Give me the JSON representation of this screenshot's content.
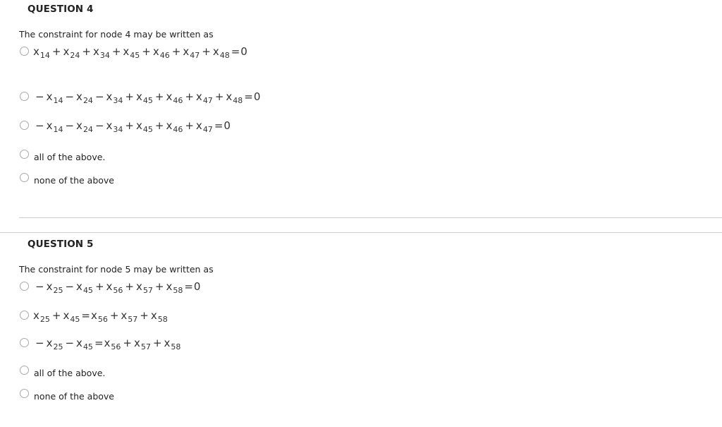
{
  "questions": [
    {
      "title": "QUESTION 4",
      "prompt": "The constraint for node 4 may be written as",
      "options": [
        {
          "type": "math",
          "tokens": [
            {
              "v": "x",
              "s": "14"
            },
            {
              "op": "+"
            },
            {
              "v": "x",
              "s": "24"
            },
            {
              "op": "+"
            },
            {
              "v": "x",
              "s": "34"
            },
            {
              "op": "+"
            },
            {
              "v": "x",
              "s": "45"
            },
            {
              "op": "+"
            },
            {
              "v": "x",
              "s": "46"
            },
            {
              "op": "+"
            },
            {
              "v": "x",
              "s": "47"
            },
            {
              "op": "+"
            },
            {
              "v": "x",
              "s": "48"
            },
            {
              "eq": "="
            },
            {
              "c": "0"
            }
          ]
        },
        {
          "type": "math",
          "tokens": [
            {
              "op": "−"
            },
            {
              "v": "x",
              "s": "14"
            },
            {
              "op": "−"
            },
            {
              "v": "x",
              "s": "24"
            },
            {
              "op": "−"
            },
            {
              "v": "x",
              "s": "34"
            },
            {
              "op": "+"
            },
            {
              "v": "x",
              "s": "45"
            },
            {
              "op": "+"
            },
            {
              "v": "x",
              "s": "46"
            },
            {
              "op": "+"
            },
            {
              "v": "x",
              "s": "47"
            },
            {
              "op": "+"
            },
            {
              "v": "x",
              "s": "48"
            },
            {
              "eq": "="
            },
            {
              "c": "0"
            }
          ]
        },
        {
          "type": "math",
          "tokens": [
            {
              "op": "−"
            },
            {
              "v": "x",
              "s": "14"
            },
            {
              "op": "−"
            },
            {
              "v": "x",
              "s": "24"
            },
            {
              "op": "−"
            },
            {
              "v": "x",
              "s": "34"
            },
            {
              "op": "+"
            },
            {
              "v": "x",
              "s": "45"
            },
            {
              "op": "+"
            },
            {
              "v": "x",
              "s": "46"
            },
            {
              "op": "+"
            },
            {
              "v": "x",
              "s": "47"
            },
            {
              "eq": "="
            },
            {
              "c": "0"
            }
          ]
        },
        {
          "type": "text",
          "label": "all of the above."
        },
        {
          "type": "text",
          "label": "none of the above"
        }
      ]
    },
    {
      "title": "QUESTION 5",
      "prompt": "The constraint for node 5 may be written as",
      "options": [
        {
          "type": "math",
          "tokens": [
            {
              "op": "−"
            },
            {
              "v": "x",
              "s": "25"
            },
            {
              "op": "−"
            },
            {
              "v": "x",
              "s": "45"
            },
            {
              "op": "+"
            },
            {
              "v": "x",
              "s": "56"
            },
            {
              "op": "+"
            },
            {
              "v": "x",
              "s": "57"
            },
            {
              "op": "+"
            },
            {
              "v": "x",
              "s": "58"
            },
            {
              "eq": "="
            },
            {
              "c": "0"
            }
          ]
        },
        {
          "type": "math",
          "tokens": [
            {
              "v": "x",
              "s": "25"
            },
            {
              "op": "+"
            },
            {
              "v": "x",
              "s": "45"
            },
            {
              "eq": "="
            },
            {
              "v": "x",
              "s": "56"
            },
            {
              "op": "+"
            },
            {
              "v": "x",
              "s": "57"
            },
            {
              "op": "+"
            },
            {
              "v": "x",
              "s": "58"
            }
          ]
        },
        {
          "type": "math",
          "tokens": [
            {
              "op": "−"
            },
            {
              "v": "x",
              "s": "25"
            },
            {
              "op": "−"
            },
            {
              "v": "x",
              "s": "45"
            },
            {
              "eq": "="
            },
            {
              "v": "x",
              "s": "56"
            },
            {
              "op": "+"
            },
            {
              "v": "x",
              "s": "57"
            },
            {
              "op": "+"
            },
            {
              "v": "x",
              "s": "58"
            }
          ]
        },
        {
          "type": "text",
          "label": "all of the above."
        },
        {
          "type": "text",
          "label": "none of the above"
        }
      ]
    }
  ]
}
